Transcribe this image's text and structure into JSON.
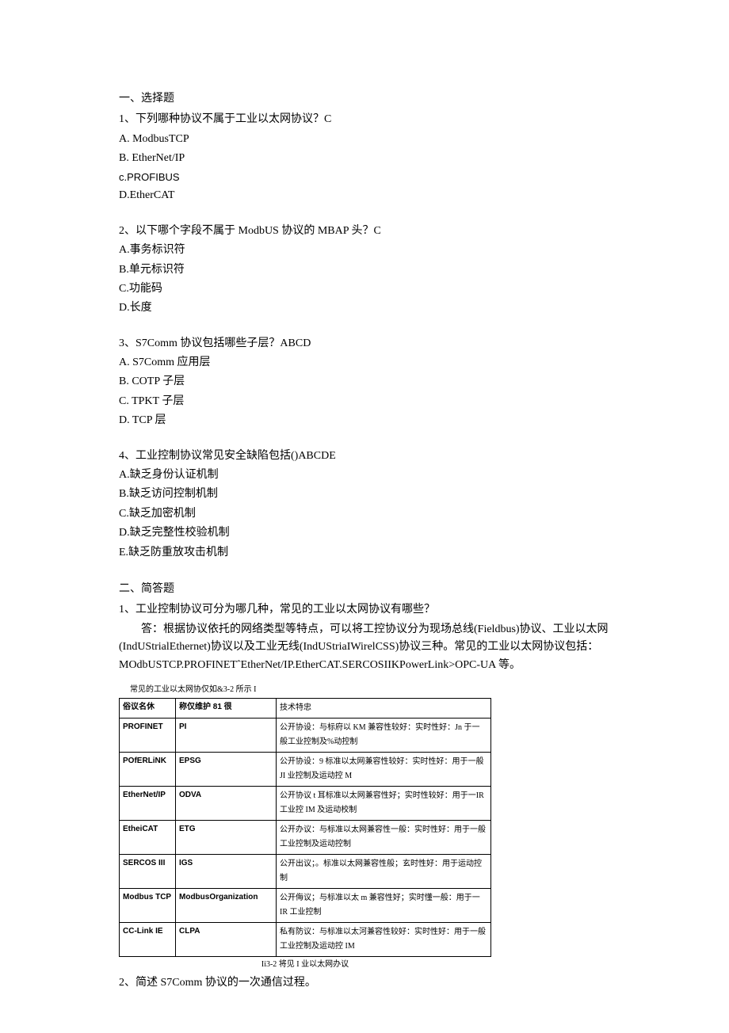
{
  "sec1_title": "一、选择题",
  "q1": {
    "text": "1、下列哪种协议不属于工业以太网协议？C",
    "a": "A.  ModbusTCP",
    "b": "B.  EtherNet/IP",
    "c": "c.PROFIBUS",
    "d": "D.EtherCAT"
  },
  "q2": {
    "text": "2、以下哪个字段不属于 ModbUS 协议的 MBAP 头？C",
    "a": "A.事务标识符",
    "b": "B.单元标识符",
    "c": "C.功能码",
    "d": "D.长度"
  },
  "q3": {
    "text": "3、S7Comm 协议包括哪些子层？ABCD",
    "a": "A.  S7Comm 应用层",
    "b": "B.  COTP 子层",
    "c": "C.  TPKT 子层",
    "d": "D.  TCP 层"
  },
  "q4": {
    "text": "4、工业控制协议常见安全缺陷包括()ABCDE",
    "a": "A.缺乏身份认证机制",
    "b": "B.缺乏访问控制机制",
    "c": "C.缺乏加密机制",
    "d": "D.缺乏完整性校验机制",
    "e": "E.缺乏防重放攻击机制"
  },
  "sec2_title": "二、简答题",
  "sq1": {
    "text": "1、工业控制协议可分为哪几种，常见的工业以太网协议有哪些？",
    "ans": "答：根据协议依托的网络类型等特点，可以将工控协议分为现场总线(Fieldbus)协议、工业以太网(IndUStrialEthernet)协议以及工业无线(IndUStriaIWirelCSS)协议三种。常见的工业以太网协议包括：MOdbUSTCP.PROFINETˆEtherNet/IP.EtherCAT.SERCOSIIKPowerLink>OPC-UA 等。"
  },
  "table": {
    "caption": "常见的工业以太网协仅如&3-2 所示 I",
    "h1": "俗议名休",
    "h2": "称仅维护 81 很",
    "h3": "技术特忠",
    "rows": [
      {
        "name": "PROFINET",
        "org": "PI",
        "feat": "公开协设：与标府以 KM 兼容性较好：实时性好：Jn 于一般工业控制及%动控制"
      },
      {
        "name": "POfERLiNK",
        "org": "EPSG",
        "feat": "公开协设：9 标准以太网兼容性较好：实时性好：用于一般 JI 业控制及运动控 M"
      },
      {
        "name": "EtherNet/IP",
        "org": "ODVA",
        "feat": "公开协议 t 耳标准以太网兼容性好；实时性较好：用于一IR 工业控 IM 及运动校制"
      },
      {
        "name": "EtheiCAT",
        "org": "ETG",
        "feat": "公开办议：与标准以太网兼容性一般：实时性好：用于一般工业控制及运动控制"
      },
      {
        "name": "SERCOS III",
        "org": "IGS",
        "feat": "公开出议；。标准以太网兼容性般；玄时性好：用于运动控制"
      },
      {
        "name": "Modbus TCP",
        "org": "ModbusOrganization",
        "feat": "公开侮议；与标准以太 m 兼容性好；实时懂一般：用于一 IR 工业控制"
      },
      {
        "name": "CC-Link IE",
        "org": "CLPA",
        "feat": "私有防议：与标准以太河兼容性较好：实时性好：用于一般工业控制及运动控 IM"
      }
    ],
    "footer": "Ii3-2 将见 I 业以太网办议"
  },
  "sq2": {
    "text": "2、简述 S7Comm 协议的一次通信过程。"
  }
}
